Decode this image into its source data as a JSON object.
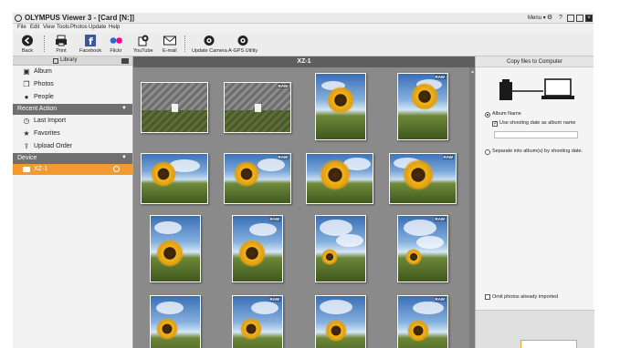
{
  "window": {
    "title": "OLYMPUS Viewer 3 - [Card [N:]]",
    "menu_button": "Menu ▾",
    "controls": [
      "⚙",
      "?",
      "_",
      "□",
      "×"
    ]
  },
  "menubar": [
    "File",
    "Edit",
    "View",
    "Tools",
    "Photos",
    "Update",
    "Help"
  ],
  "toolbar": {
    "back": "Back",
    "print": "Print",
    "facebook": "Facebook",
    "flickr": "Flickr",
    "youtube": "YouTube",
    "email": "E-mail",
    "update_camera": "Update Camera",
    "agps": "A-GPS Utility"
  },
  "sidebar": {
    "header": "Library",
    "library_items": [
      "Album",
      "Photos",
      "People"
    ],
    "recent_action_header": "Recent Action",
    "recent_items": [
      "Last Import",
      "Favorites",
      "Upload Order"
    ],
    "device_header": "Device",
    "device_name": "XZ-1"
  },
  "main": {
    "title": "XZ-1",
    "raw_badge": "RAW"
  },
  "right_panel": {
    "header": "Copy files to Computer",
    "album_name_label": "Album Name",
    "use_shooting_date": "Use shooting date as album name",
    "separate_by_date": "Separate into album(s) by shooting date.",
    "omit_imported": "Omit photos already imported"
  },
  "colors": {
    "accent_orange": "#f29a2e",
    "section_gray": "#6f6f6f",
    "main_bg": "#8a8a8a",
    "facebook_blue": "#3b5998",
    "flickr_blue": "#1e6fd9",
    "flickr_pink": "#ff0084"
  }
}
